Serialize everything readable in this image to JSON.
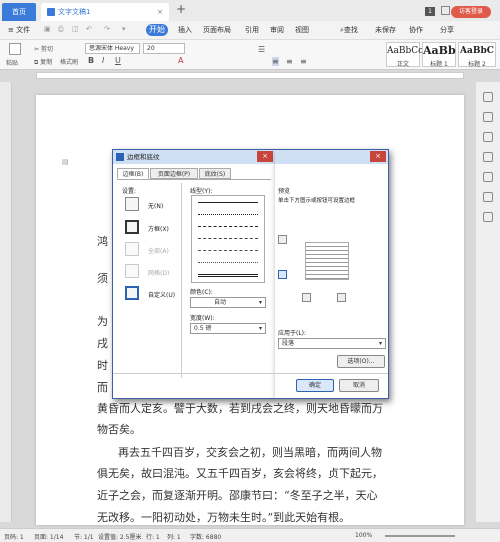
{
  "titlebar": {
    "home_tab": "首页",
    "doc_tab": "文字文稿1",
    "badge": "1",
    "login": "访客登录"
  },
  "menubar": {
    "file": "≡ 文件",
    "start": "开始",
    "items": [
      "插入",
      "页面布局",
      "引用",
      "审阅",
      "视图"
    ],
    "search": "查找",
    "unsaved": "未保存",
    "collab": "协作",
    "share": "分享"
  },
  "toolbar": {
    "paste": "粘贴",
    "cut": "剪切",
    "copy": "复制",
    "format_painter": "格式刷",
    "font_name": "思源宋体 Heavy",
    "font_size": "20",
    "styles": [
      {
        "preview": "AaBbCcDd",
        "name": "正文"
      },
      {
        "preview": "AaBb",
        "name": "标题 1"
      },
      {
        "preview": "AaBbC",
        "name": "标题 2"
      }
    ]
  },
  "document": {
    "partial_left": [
      "鸿",
      "须",
      "为",
      "戌",
      "时",
      "而"
    ],
    "lines": [
      "黄昏而人定亥。譬于大数，若到戌会之终，则天地昏曚而万",
      "物否矣。",
      "再去五千四百岁，交亥会之初，则当黑暗，而两间人物",
      "俱无矣，故曰混沌。又五千四百岁，亥会将终，贞下起元，",
      "近子之会，而复逐渐开明。邵康节曰：“冬至子之半，天心",
      "无改移。一阳初动处，万物未生时。”到此天始有根。"
    ]
  },
  "statusbar": {
    "page": "页码: 1",
    "pages": "页面: 1/14",
    "section": "节: 1/1",
    "setting": "设置值: 2.5厘米",
    "row": "行: 1",
    "col": "列: 1",
    "words": "字数: 6880",
    "zoom": "100%"
  },
  "dialog": {
    "title": "边框和底纹",
    "tabs": [
      "边框(B)",
      "页面边框(P)",
      "底纹(S)"
    ],
    "setting_label": "设置:",
    "settings": [
      "无(N)",
      "方框(X)",
      "全部(A)",
      "网格(D)",
      "自定义(U)"
    ],
    "line_style_label": "线型(Y):",
    "color_label": "颜色(C):",
    "color_value": "自动",
    "width_label": "宽度(W):",
    "width_value": "0.5 磅",
    "preview_label": "预览",
    "preview_hint": "单击下方图示或按钮可设置边框",
    "apply_label": "应用于(L):",
    "apply_value": "段落",
    "options_button": "选项(O)...",
    "ok_button": "确定",
    "cancel_button": "取消"
  }
}
